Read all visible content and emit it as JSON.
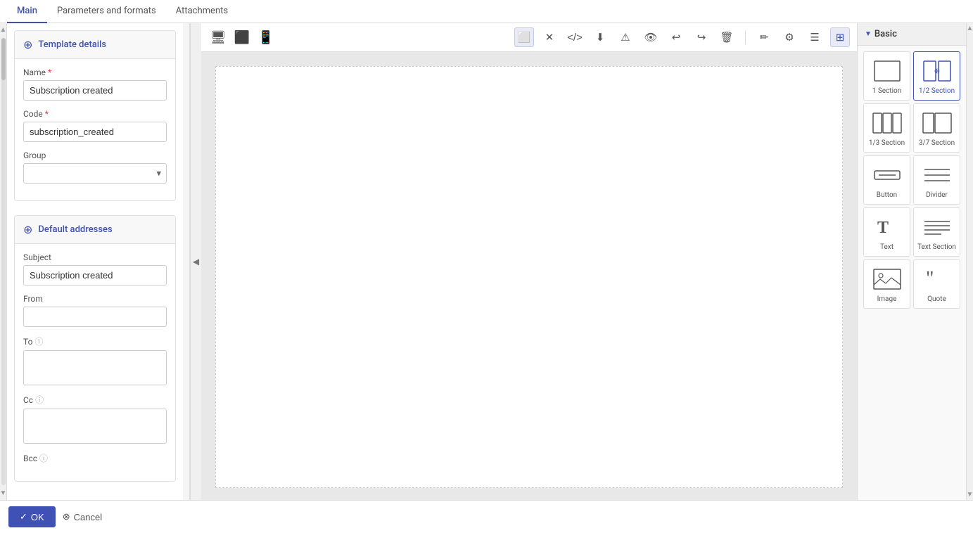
{
  "tabs": [
    {
      "id": "main",
      "label": "Main",
      "active": true
    },
    {
      "id": "parameters",
      "label": "Parameters and formats",
      "active": false
    },
    {
      "id": "attachments",
      "label": "Attachments",
      "active": false
    }
  ],
  "left_panel": {
    "template_details": {
      "title": "Template details",
      "name_label": "Name",
      "name_required": true,
      "name_value": "Subscription created",
      "code_label": "Code",
      "code_required": true,
      "code_value": "subscription_created",
      "group_label": "Group",
      "group_value": ""
    },
    "default_addresses": {
      "title": "Default addresses",
      "subject_label": "Subject",
      "subject_value": "Subscription created",
      "from_label": "From",
      "from_value": "",
      "to_label": "To",
      "to_value": "",
      "cc_label": "Cc",
      "cc_value": "",
      "bcc_label": "Bcc",
      "bcc_value": ""
    }
  },
  "toolbar": {
    "device_icons": [
      "desktop",
      "tablet",
      "mobile"
    ],
    "icons": [
      "fullscreen",
      "fullscreen-exit",
      "code",
      "download",
      "warning",
      "eye",
      "undo",
      "redo",
      "delete",
      "pen",
      "settings",
      "menu",
      "grid"
    ]
  },
  "right_panel": {
    "section_label": "Basic",
    "blocks": [
      {
        "id": "section-1",
        "label": "1 Section",
        "active": false
      },
      {
        "id": "section-12",
        "label": "1/2 Section",
        "active": true
      },
      {
        "id": "section-13",
        "label": "1/3 Section",
        "active": false
      },
      {
        "id": "section-37",
        "label": "3/7 Section",
        "active": false
      },
      {
        "id": "button",
        "label": "Button",
        "active": false
      },
      {
        "id": "divider",
        "label": "Divider",
        "active": false
      },
      {
        "id": "text",
        "label": "Text",
        "active": false
      },
      {
        "id": "text-section",
        "label": "Text Section",
        "active": false
      },
      {
        "id": "image",
        "label": "Image",
        "active": false
      },
      {
        "id": "quote",
        "label": "Quote",
        "active": false
      }
    ]
  },
  "bottom": {
    "ok_label": "OK",
    "cancel_label": "Cancel"
  }
}
